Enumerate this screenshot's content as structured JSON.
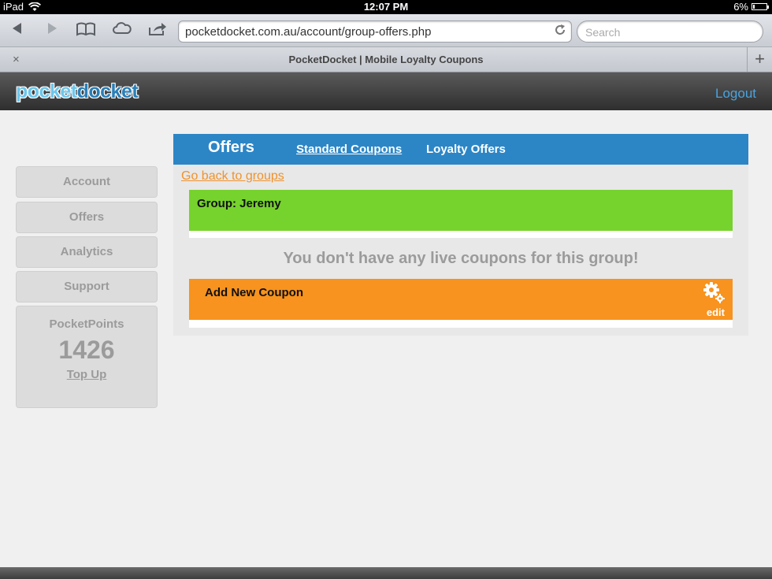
{
  "status_bar": {
    "device": "iPad",
    "time": "12:07 PM",
    "battery": "6%"
  },
  "browser": {
    "url": "pocketdocket.com.au/account/group-offers.php",
    "search_placeholder": "Search",
    "tab_title": "PocketDocket | Mobile Loyalty Coupons",
    "tab_close": "×",
    "new_tab": "+"
  },
  "header": {
    "logo_part1": "pocket",
    "logo_part2": "docket",
    "logout": "Logout"
  },
  "sidebar": {
    "items": [
      {
        "label": "Account"
      },
      {
        "label": "Offers"
      },
      {
        "label": "Analytics"
      },
      {
        "label": "Support"
      }
    ],
    "points_label": "PocketPoints",
    "points_value": "1426",
    "topup": "Top Up"
  },
  "main": {
    "tabs": {
      "active": "Offers",
      "standard": "Standard Coupons",
      "loyalty": "Loyalty Offers"
    },
    "back_link": "Go back to groups",
    "group_title": "Group: Jeremy",
    "empty_message": "You don't have any live coupons for this group!",
    "add_coupon": "Add New Coupon",
    "edit": "edit"
  },
  "colors": {
    "tab_bar": "#2c86c6",
    "group": "#76d22d",
    "add": "#f7931e",
    "link": "#4aa3df"
  }
}
